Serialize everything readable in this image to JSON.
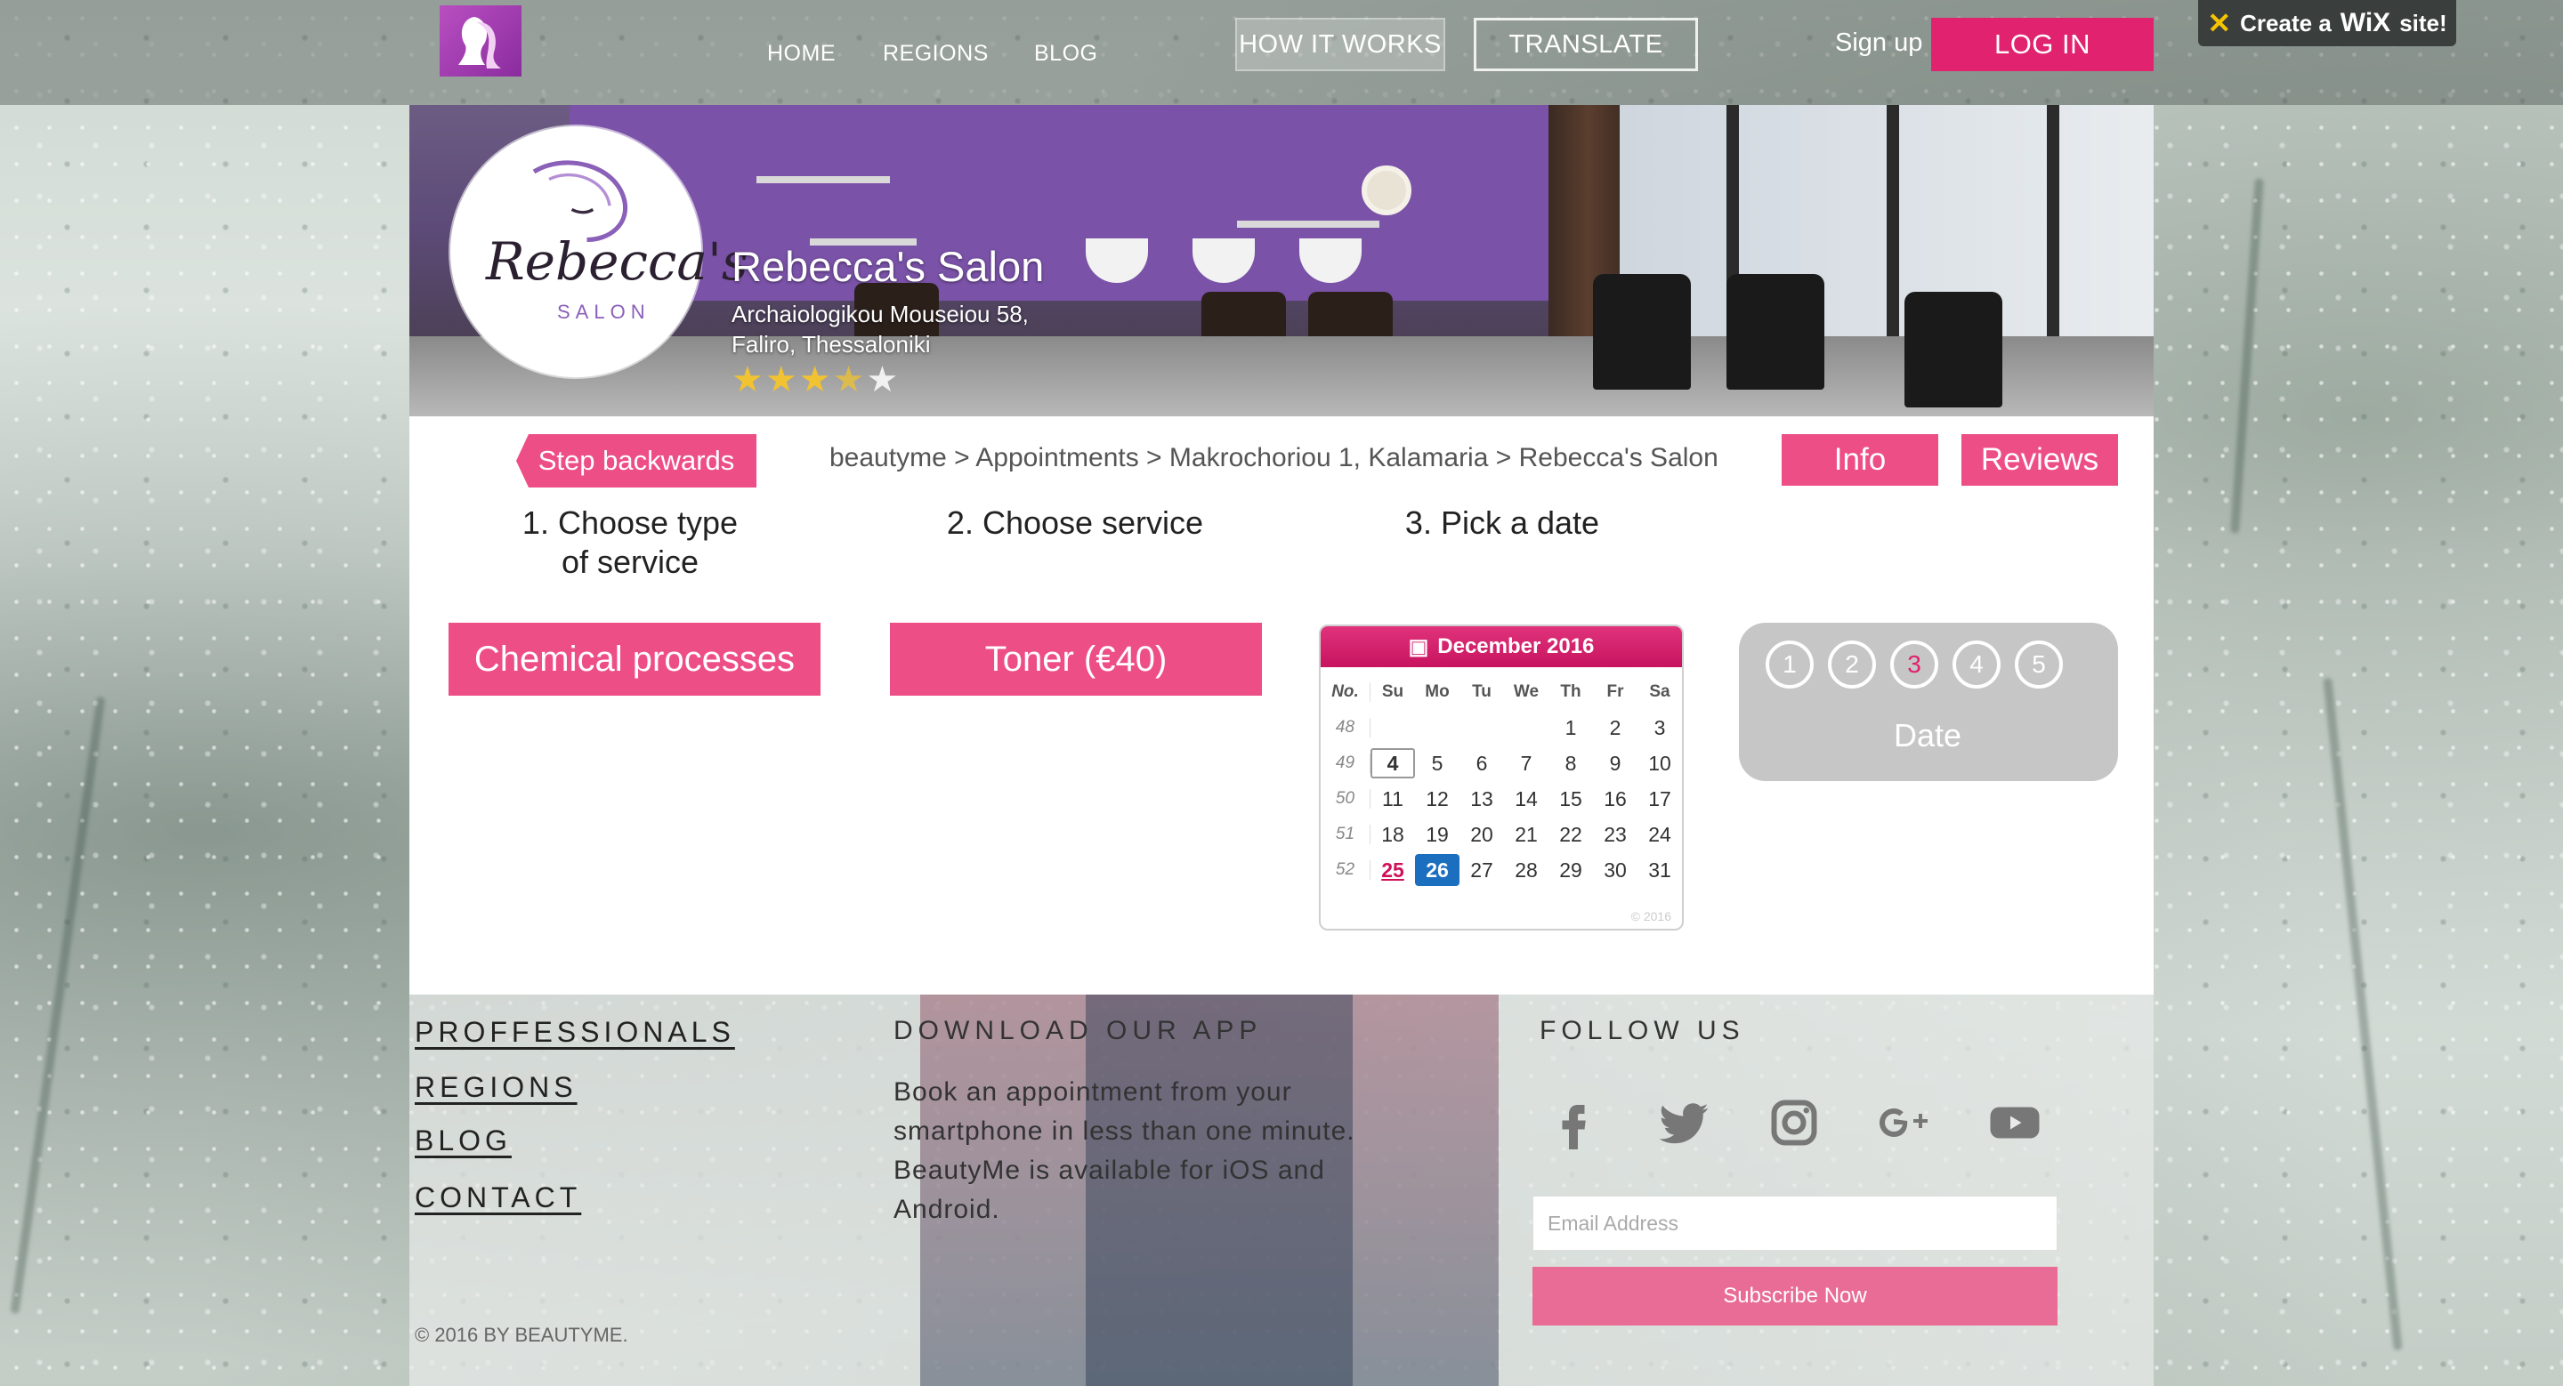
{
  "nav": {
    "items": [
      "HOME",
      "REGIONS",
      "BLOG"
    ],
    "how_it_works": "HOW IT WORKS",
    "translate": "TRANSLATE",
    "sign_up": "Sign up",
    "log_in": "LOG IN"
  },
  "wix_badge": {
    "prefix": "Create a",
    "brand": "WiX",
    "suffix": "site!"
  },
  "salon": {
    "logo_script": "Rebecca's",
    "logo_sub": "SALON",
    "name": "Rebecca's Salon",
    "address_line1": "Archaiologikou Mouseiou 58,",
    "address_line2": "Faliro, Thessaloniki",
    "rating": 3.5,
    "rating_max": 5
  },
  "booking": {
    "step_back": "Step backwards",
    "breadcrumb": "beautyme > Appointments > Makrochoriou 1, Kalamaria > Rebecca's Salon",
    "info_tab": "Info",
    "reviews_tab": "Reviews",
    "step1_line1": "1. Choose type",
    "step1_line2": "of service",
    "step2": "2. Choose service",
    "step3": "3. Pick a date",
    "service_type": "Chemical processes",
    "service": "Toner (€40)",
    "progress_steps": [
      "1",
      "2",
      "3",
      "4",
      "5"
    ],
    "progress_active": 3,
    "progress_label": "Date"
  },
  "calendar": {
    "month": "December 2016",
    "week_header": "No.",
    "weekdays": [
      "Su",
      "Mo",
      "Tu",
      "We",
      "Th",
      "Fr",
      "Sa"
    ],
    "weeks": [
      {
        "no": "48",
        "days": [
          "",
          "",
          "",
          "",
          "1",
          "2",
          "3"
        ]
      },
      {
        "no": "49",
        "days": [
          "4",
          "5",
          "6",
          "7",
          "8",
          "9",
          "10"
        ]
      },
      {
        "no": "50",
        "days": [
          "11",
          "12",
          "13",
          "14",
          "15",
          "16",
          "17"
        ]
      },
      {
        "no": "51",
        "days": [
          "18",
          "19",
          "20",
          "21",
          "22",
          "23",
          "24"
        ]
      },
      {
        "no": "52",
        "days": [
          "25",
          "26",
          "27",
          "28",
          "29",
          "30",
          "31"
        ]
      }
    ],
    "today": "4",
    "holiday": "25",
    "selected": "26"
  },
  "footer": {
    "links": [
      "PROFFESSIONALS",
      "REGIONS",
      "BLOG",
      "CONTACT"
    ],
    "download_heading": "DOWNLOAD OUR APP",
    "download_text": "Book an appointment from your smartphone in less than one minute. BeautyMe is available for iOS and Android.",
    "follow_heading": "FOLLOW US",
    "social_icons": [
      "facebook-icon",
      "twitter-icon",
      "instagram-icon",
      "google-plus-icon",
      "youtube-icon"
    ],
    "email_placeholder": "Email Address",
    "subscribe": "Subscribe Now",
    "copyright": "© 2016 BY BEAUTYME."
  },
  "colors": {
    "brand_pink": "#ee4e86",
    "login_pink": "#e0226f",
    "selected_blue": "#1c6fbf"
  }
}
